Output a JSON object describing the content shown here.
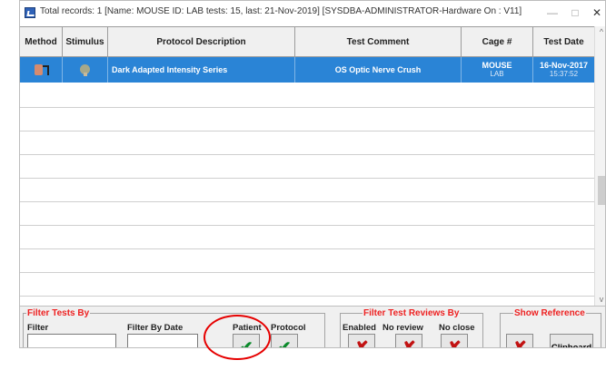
{
  "window": {
    "title": "Total records: 1  [Name:  MOUSE ID: LAB tests: 15, last: 21-Nov-2019] [SYSDBA-ADMINISTRATOR-Hardware On : V11]",
    "minimize_label": "—",
    "maximize_label": "□",
    "close_label": "✕"
  },
  "table": {
    "columns": [
      "Method",
      "Stimulus",
      "Protocol Description",
      "Test Comment",
      "Cage #",
      "Test Date"
    ],
    "rows": [
      {
        "method_icon": "electrode-icon",
        "stimulus_icon": "mouse-icon",
        "protocol": "Dark Adapted Intensity Series",
        "comment": "OS Optic Nerve Crush",
        "cage_line1": "MOUSE",
        "cage_line2": "LAB",
        "date": "16-Nov-2017",
        "time": "15:37:52",
        "selected": true
      }
    ],
    "selected_color": "#2a84d6"
  },
  "scrollbar": {
    "up": "^",
    "down": "v"
  },
  "footer": {
    "filter_tests": {
      "legend": "Filter Tests By",
      "filter_label": "Filter",
      "filter_value": "",
      "date_label": "Filter By Date",
      "date_value": "",
      "patient_label": "Patient",
      "protocol_label": "Protocol",
      "patient_icon": "checkmark-icon",
      "protocol_icon": "checkmark-icon"
    },
    "filter_reviews": {
      "legend": "Filter Test Reviews By",
      "enabled_label": "Enabled",
      "no_review_label": "No review",
      "no_close_label": "No close",
      "icon": "cross-icon"
    },
    "show_reference": {
      "legend": "Show Reference",
      "icon": "cross-icon",
      "clipboard_label": "Clipboard"
    }
  },
  "symbols": {
    "check": "✔",
    "cross": "✘"
  },
  "colors": {
    "legend": "#e22222",
    "check": "#0a8a2a",
    "cross": "#c21212",
    "highlight": "#e60000"
  }
}
